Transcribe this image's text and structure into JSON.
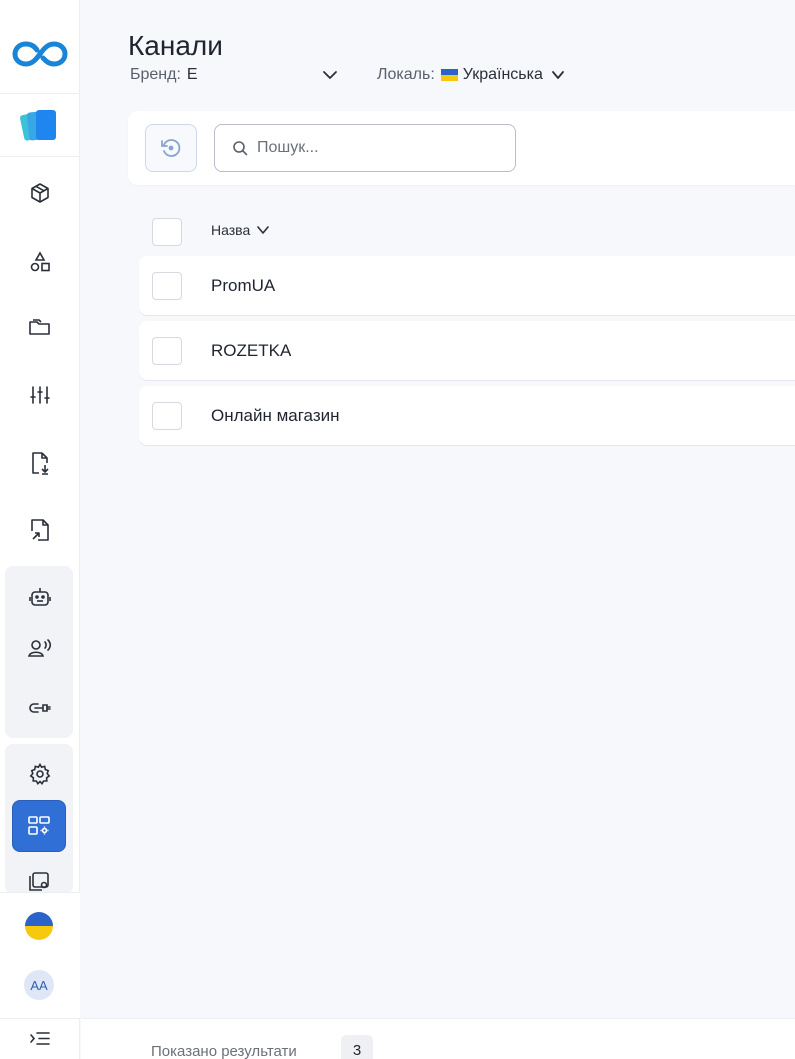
{
  "header": {
    "title": "Канали",
    "brand_label": "Бренд:",
    "brand_value": "E",
    "locale_label": "Локаль:",
    "locale_value": "Українська"
  },
  "toolbar": {
    "search_placeholder": "Пошук..."
  },
  "table": {
    "column_name": "Назва",
    "rows": [
      {
        "name": "PromUA"
      },
      {
        "name": "ROZETKA"
      },
      {
        "name": "Онлайн магазин"
      }
    ]
  },
  "footer": {
    "results_label": "Показано результати",
    "results_count": "3"
  },
  "user": {
    "initials": "AA"
  },
  "colors": {
    "accent": "#2f6fd6",
    "logo": "#1a84d6",
    "background": "#f7f8fb",
    "flag_blue": "#2c63c9",
    "flag_yellow": "#f6c90e"
  },
  "icons": {
    "sidebar": [
      "infinity-logo-icon",
      "app-cards-icon",
      "box-icon",
      "shapes-icon",
      "folders-icon",
      "sliders-icon",
      "file-import-icon",
      "file-export-icon",
      "robot-icon",
      "user-voice-icon",
      "link-plug-icon",
      "gear-icon",
      "dashboard-settings-icon",
      "copy-settings-icon",
      "flag-icon",
      "avatar",
      "collapse-menu-icon"
    ]
  }
}
